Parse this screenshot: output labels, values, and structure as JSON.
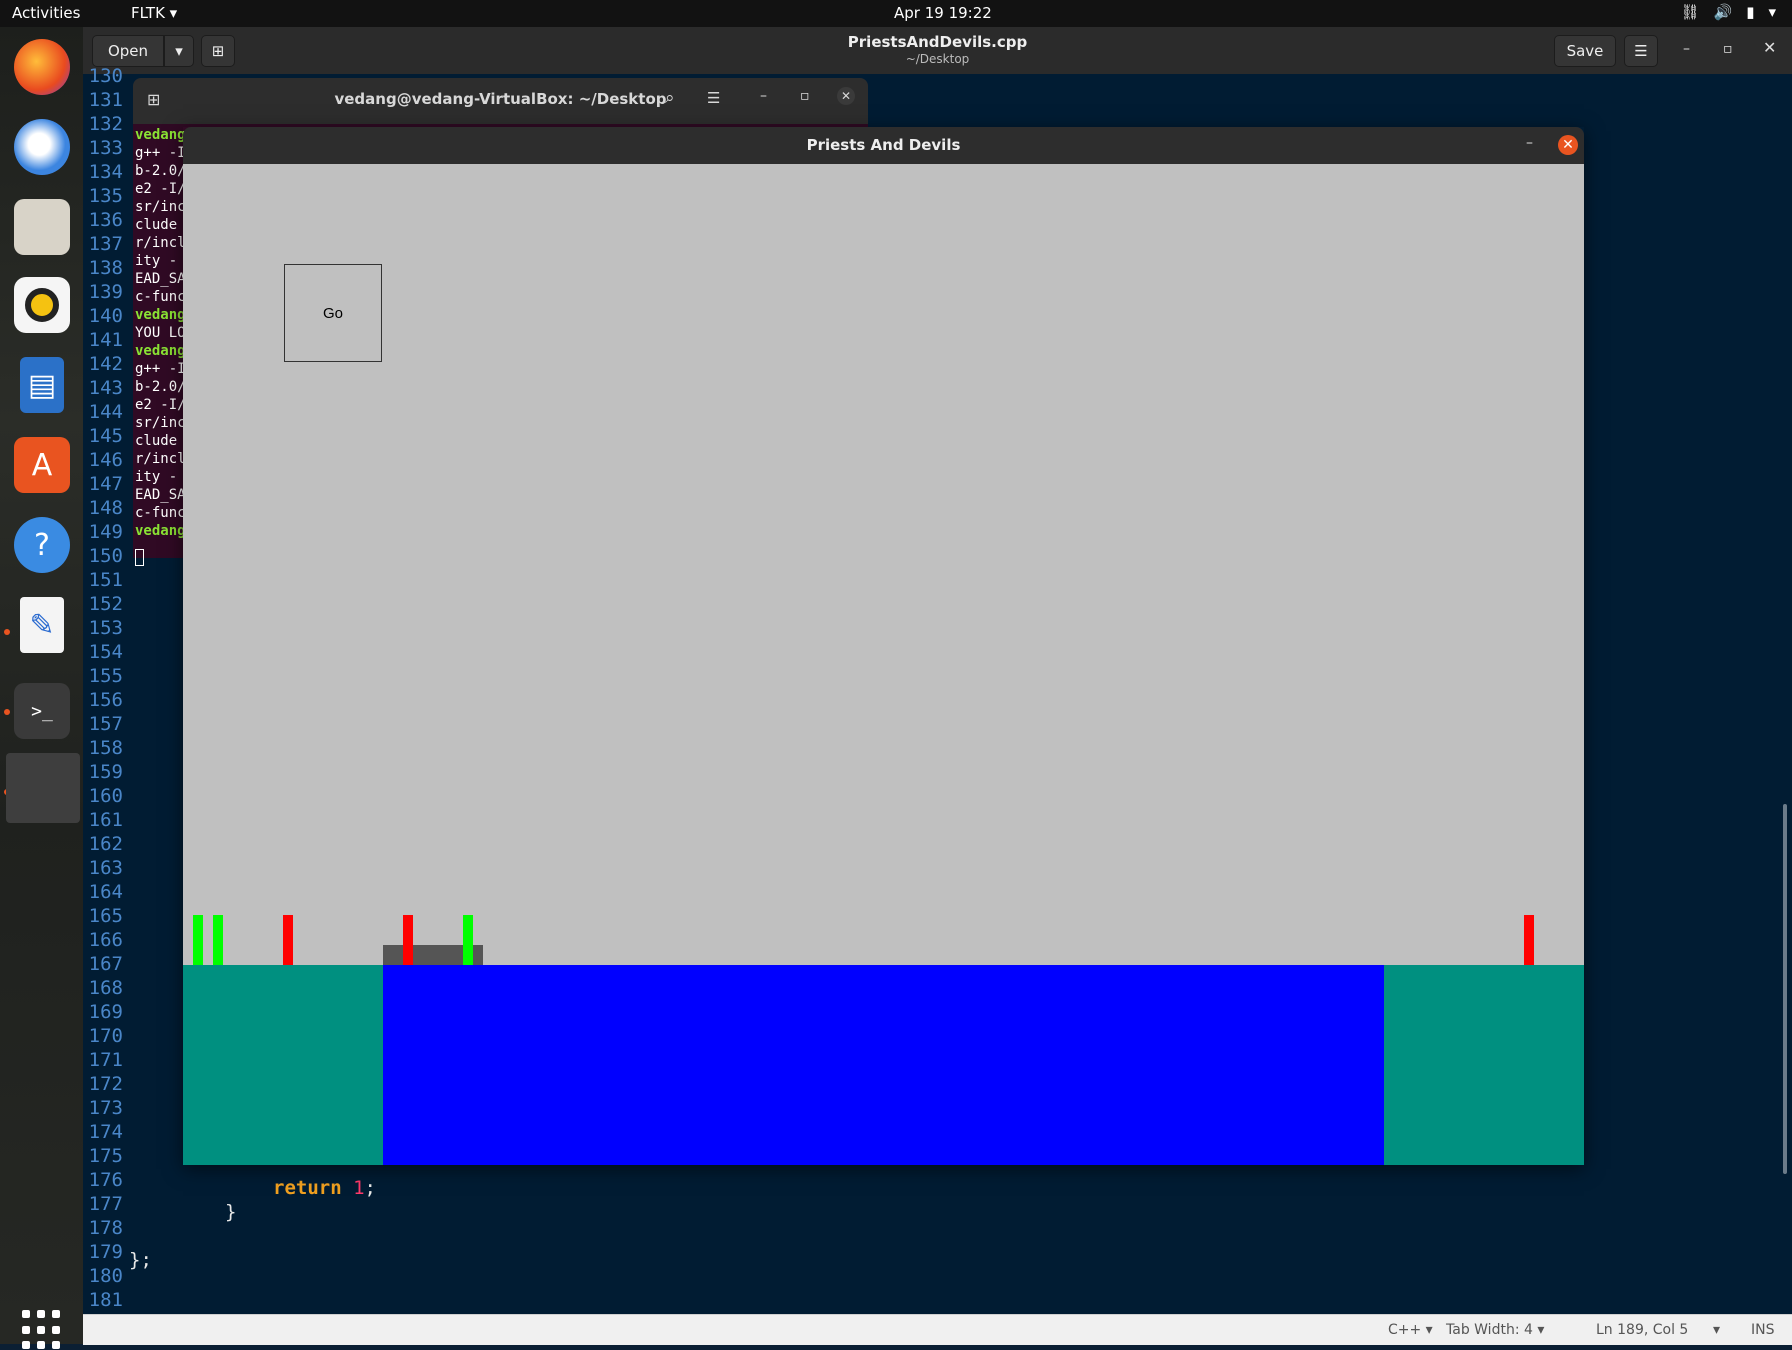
{
  "topbar": {
    "activities": "Activities",
    "app_menu": "FLTK ▾",
    "datetime": "Apr 19  19:22"
  },
  "dock": {
    "icons": [
      "firefox-icon",
      "thunderbird-icon",
      "files-icon",
      "rhythmbox-icon",
      "libreoffice-writer-icon",
      "software-center-icon",
      "help-icon",
      "text-editor-icon",
      "terminal-icon",
      "window-thumbnail-icon",
      "show-applications-icon"
    ]
  },
  "editor": {
    "open_label": "Open",
    "save_label": "Save",
    "title": "PriestsAndDevils.cpp",
    "subtitle": "~/Desktop",
    "line_numbers": [
      "130",
      "131",
      "132",
      "133",
      "134",
      "135",
      "136",
      "137",
      "138",
      "139",
      "140",
      "141",
      "142",
      "143",
      "144",
      "145",
      "146",
      "147",
      "148",
      "149",
      "150",
      "151",
      "152",
      "153",
      "154",
      "155",
      "156",
      "157",
      "158",
      "159",
      "160",
      "161",
      "162",
      "163",
      "164",
      "165",
      "166",
      "167",
      "168",
      "169",
      "170",
      "171",
      "172",
      "173",
      "174",
      "175",
      "176",
      "177",
      "178",
      "179",
      "180",
      "181"
    ],
    "code_return_kw": "return",
    "code_return_num": "1",
    "code_return_semicolon": ";",
    "code_close_brace": "}",
    "code_class_end": "};"
  },
  "status": {
    "language": "C++ ▾",
    "tab_width": "Tab Width: 4 ▾",
    "position": "Ln 189, Col 5",
    "mode": "INS"
  },
  "terminal": {
    "title": "vedang@vedang-VirtualBox: ~/Desktop",
    "lines": [
      {
        "text": "vedang",
        "green": true
      },
      {
        "text": "g++ -I",
        "green": false
      },
      {
        "text": "b-2.0/",
        "green": false
      },
      {
        "text": "e2 -I/",
        "green": false
      },
      {
        "text": "sr/inc",
        "green": false
      },
      {
        "text": "clude ",
        "green": false
      },
      {
        "text": "r/incl",
        "green": false
      },
      {
        "text": "ity -",
        "green": false
      },
      {
        "text": "EAD_SA",
        "green": false
      },
      {
        "text": "c-func",
        "green": false
      },
      {
        "text": "vedang",
        "green": true
      },
      {
        "text": "YOU LO",
        "green": false
      },
      {
        "text": "vedang",
        "green": true
      },
      {
        "text": "g++ -I",
        "green": false
      },
      {
        "text": "b-2.0/",
        "green": false
      },
      {
        "text": "e2 -I/",
        "green": false
      },
      {
        "text": "sr/inc",
        "green": false
      },
      {
        "text": "clude ",
        "green": false
      },
      {
        "text": "r/incl",
        "green": false
      },
      {
        "text": "ity -",
        "green": false
      },
      {
        "text": "EAD_SA",
        "green": false
      },
      {
        "text": "c-func",
        "green": false
      },
      {
        "text": "vedang",
        "green": true
      }
    ]
  },
  "game": {
    "title": "Priests And Devils",
    "go_label": "Go",
    "colors": {
      "sky": "#c0c0c0",
      "bank": "#009080",
      "river": "#0000ff",
      "boat": "#555555",
      "priest": "#00ff00",
      "devil": "#ff0000"
    },
    "left_bank_characters": [
      "priest",
      "priest",
      "devil"
    ],
    "boat_characters": [
      "devil",
      "priest"
    ],
    "right_bank_characters": [
      "devil"
    ]
  }
}
